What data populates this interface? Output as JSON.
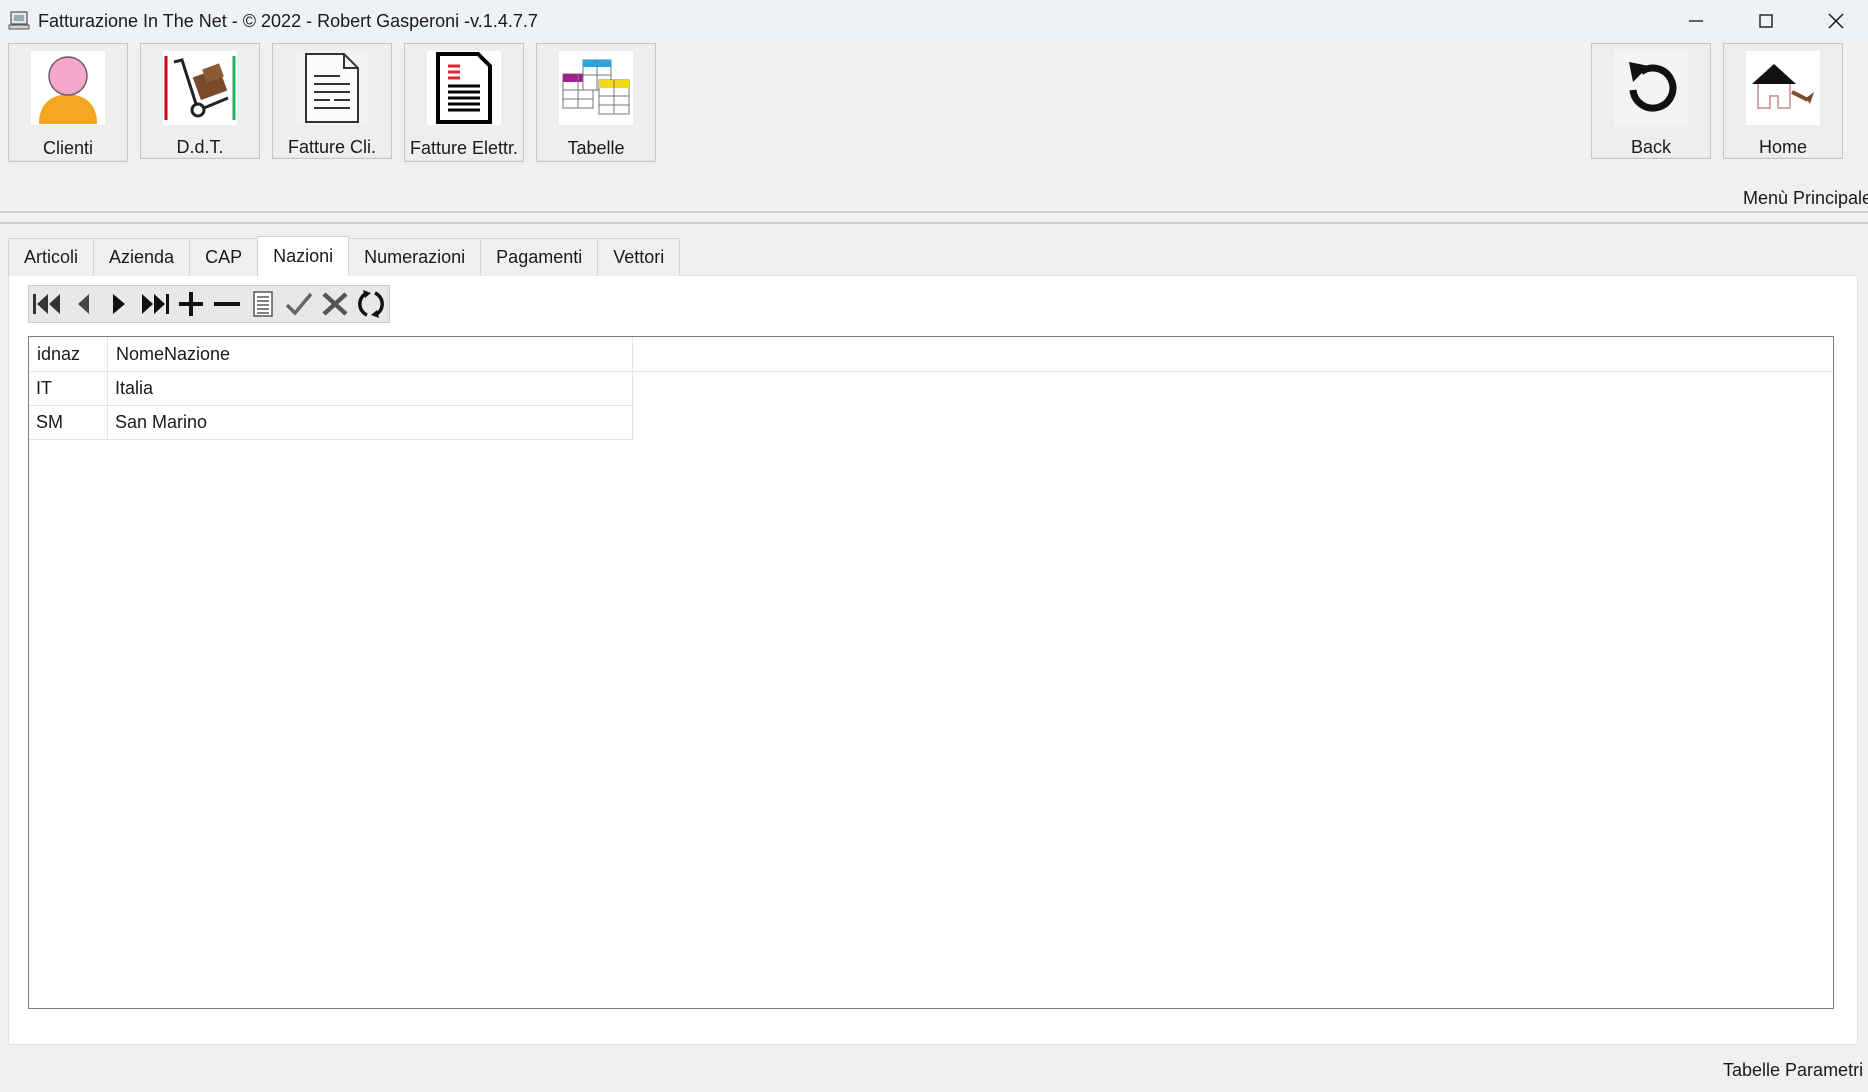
{
  "window": {
    "title": "Fatturazione In The Net - © 2022 - Robert Gasperoni -v.1.4.7.7",
    "icon": "app-icon",
    "controls": [
      "minimize-icon",
      "maximize-icon",
      "close-icon"
    ]
  },
  "toolbar": {
    "buttons": [
      {
        "label": "Clienti",
        "icon": "person-icon"
      },
      {
        "label": "D.d.T.",
        "icon": "hand-truck-icon"
      },
      {
        "label": "Fatture Cli.",
        "icon": "document-icon"
      },
      {
        "label": "Fatture Elettr.",
        "icon": "electronic-invoice-icon"
      },
      {
        "label": "Tabelle",
        "icon": "tables-icon"
      }
    ],
    "right_buttons": [
      {
        "label": "Back",
        "icon": "back-arrow-icon"
      },
      {
        "label": "Home",
        "icon": "home-icon"
      }
    ],
    "section_label": "Menù Principale"
  },
  "tabs": [
    {
      "label": "Articoli"
    },
    {
      "label": "Azienda"
    },
    {
      "label": "CAP"
    },
    {
      "label": "Nazioni",
      "active": true
    },
    {
      "label": "Numerazioni"
    },
    {
      "label": "Pagamenti"
    },
    {
      "label": "Vettori"
    }
  ],
  "navigator": {
    "buttons": [
      "first-record-icon",
      "prior-record-icon",
      "next-record-icon",
      "last-record-icon",
      "insert-icon",
      "delete-icon",
      "edit-icon",
      "post-icon",
      "cancel-icon",
      "refresh-icon"
    ]
  },
  "grid": {
    "columns": [
      "idnaz",
      "NomeNazione"
    ],
    "rows": [
      [
        "IT",
        "Italia"
      ],
      [
        "SM",
        "San Marino"
      ]
    ]
  },
  "status": {
    "section_label": "Tabelle Parametri"
  },
  "colors": {
    "accent_window": "#eef1f5",
    "panel": "#ffffff",
    "background": "#f0f0f0"
  }
}
